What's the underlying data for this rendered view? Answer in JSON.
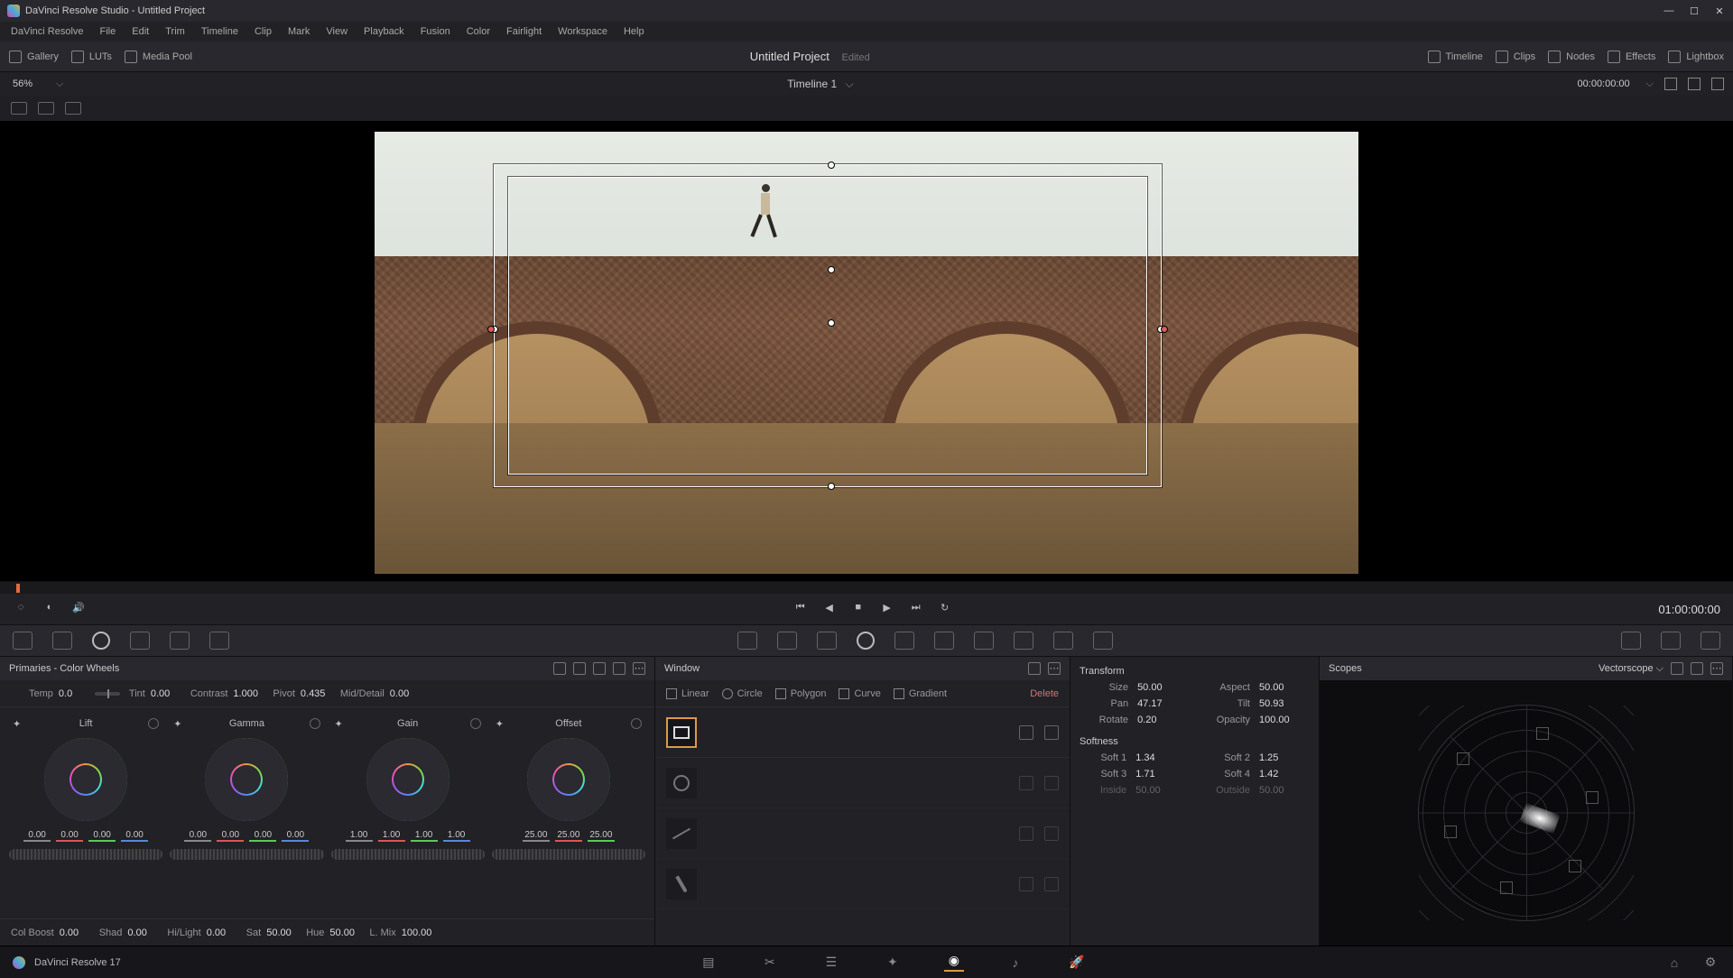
{
  "titlebar": {
    "text": "DaVinci Resolve Studio - Untitled Project"
  },
  "menubar": [
    "DaVinci Resolve",
    "File",
    "Edit",
    "Trim",
    "Timeline",
    "Clip",
    "Mark",
    "View",
    "Playback",
    "Fusion",
    "Color",
    "Fairlight",
    "Workspace",
    "Help"
  ],
  "toolbar": {
    "left": [
      {
        "icon": "gallery-icon",
        "label": "Gallery"
      },
      {
        "icon": "luts-icon",
        "label": "LUTs"
      },
      {
        "icon": "media-pool-icon",
        "label": "Media Pool"
      }
    ],
    "project_title": "Untitled Project",
    "status": "Edited",
    "right": [
      {
        "icon": "timeline-icon",
        "label": "Timeline"
      },
      {
        "icon": "clips-icon",
        "label": "Clips"
      },
      {
        "icon": "nodes-icon",
        "label": "Nodes"
      },
      {
        "icon": "effects-icon",
        "label": "Effects"
      },
      {
        "icon": "lightbox-icon",
        "label": "Lightbox"
      }
    ]
  },
  "subheader": {
    "zoom": "56%",
    "timeline_name": "Timeline 1",
    "timecode": "00:00:00:00"
  },
  "transport": {
    "timecode": "01:00:00:00"
  },
  "primaries": {
    "title": "Primaries - Color Wheels",
    "top_row": {
      "temp_label": "Temp",
      "temp": "0.0",
      "tint_label": "Tint",
      "tint": "0.00",
      "contrast_label": "Contrast",
      "contrast": "1.000",
      "pivot_label": "Pivot",
      "pivot": "0.435",
      "md_label": "Mid/Detail",
      "md": "0.00"
    },
    "wheels": [
      {
        "name": "Lift",
        "v": [
          "0.00",
          "0.00",
          "0.00",
          "0.00"
        ]
      },
      {
        "name": "Gamma",
        "v": [
          "0.00",
          "0.00",
          "0.00",
          "0.00"
        ]
      },
      {
        "name": "Gain",
        "v": [
          "1.00",
          "1.00",
          "1.00",
          "1.00"
        ]
      },
      {
        "name": "Offset",
        "v": [
          "25.00",
          "25.00",
          "25.00"
        ]
      }
    ],
    "bottom_row": {
      "colboost_label": "Col Boost",
      "colboost": "0.00",
      "shad_label": "Shad",
      "shad": "0.00",
      "hilight_label": "Hi/Light",
      "hilight": "0.00",
      "sat_label": "Sat",
      "sat": "50.00",
      "hue_label": "Hue",
      "hue": "50.00",
      "lmix_label": "L. Mix",
      "lmix": "100.00"
    }
  },
  "window": {
    "title": "Window",
    "shapes": [
      "Linear",
      "Circle",
      "Polygon",
      "Curve",
      "Gradient"
    ],
    "delete_label": "Delete"
  },
  "transform": {
    "title": "Transform",
    "size_label": "Size",
    "size": "50.00",
    "aspect_label": "Aspect",
    "aspect": "50.00",
    "pan_label": "Pan",
    "pan": "47.17",
    "tilt_label": "Tilt",
    "tilt": "50.93",
    "rotate_label": "Rotate",
    "rotate": "0.20",
    "opacity_label": "Opacity",
    "opacity": "100.00",
    "soft_title": "Softness",
    "s1_label": "Soft 1",
    "s1": "1.34",
    "s2_label": "Soft 2",
    "s2": "1.25",
    "s3_label": "Soft 3",
    "s3": "1.71",
    "s4_label": "Soft 4",
    "s4": "1.42",
    "inside_label": "Inside",
    "inside": "50.00",
    "outside_label": "Outside",
    "outside": "50.00"
  },
  "scopes": {
    "title": "Scopes",
    "mode": "Vectorscope"
  },
  "pagebar": {
    "app": "DaVinci Resolve 17"
  }
}
